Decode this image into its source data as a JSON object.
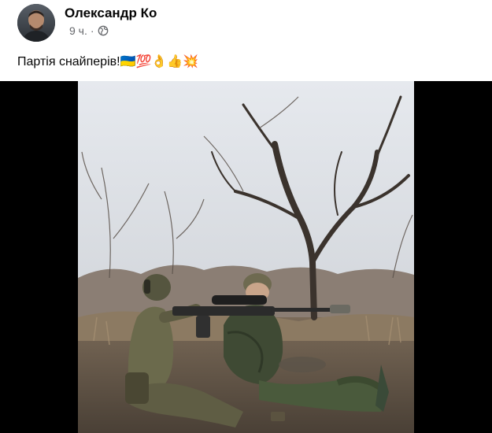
{
  "post": {
    "author": "Олександр Ко",
    "time": "9 ч.",
    "separator": "·",
    "privacy_icon": "globe-icon",
    "text": "Партія снайперів!",
    "emojis": "🇺🇦💯👌👍💥"
  },
  "media": {
    "type": "video",
    "background": "#000000"
  },
  "colors": {
    "name": "#050505",
    "meta": "#65676b"
  }
}
